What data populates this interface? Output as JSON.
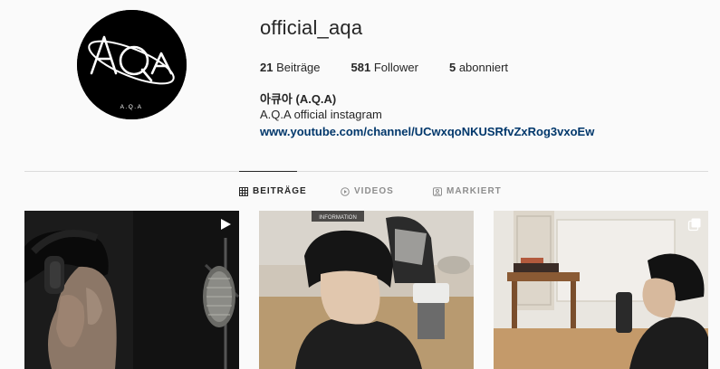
{
  "profile": {
    "username": "official_aqa",
    "avatar_logo_text": "A.Q.A",
    "avatar_small_text": "A.Q.A",
    "full_name": "아큐아 (A.Q.A)",
    "bio": "A.Q.A official instagram",
    "link": "www.youtube.com/channel/UCwxqoNKUSRfvZxRog3vxoEw"
  },
  "stats": {
    "posts": {
      "count": "21",
      "label": "Beiträge"
    },
    "followers": {
      "count": "581",
      "label": "Follower"
    },
    "following": {
      "count": "5",
      "label": "abonniert"
    }
  },
  "tabs": [
    {
      "label": "BEITRÄGE",
      "icon": "grid-icon",
      "active": true
    },
    {
      "label": "VIDEOS",
      "icon": "play-circle-icon",
      "active": false
    },
    {
      "label": "MARKIERT",
      "icon": "tag-user-icon",
      "active": false
    }
  ],
  "posts": [
    {
      "badge": "video-icon",
      "subject": "person with headphones at microphone"
    },
    {
      "badge": "",
      "subject": "person in black turtleneck in salon",
      "sign_text": "INFORMATION"
    },
    {
      "badge": "multiple-images-icon",
      "subject": "person in profile in makeup room"
    }
  ],
  "colors": {
    "background": "#fafafa",
    "text": "#262626",
    "muted": "#8e8e8e",
    "link": "#00376b",
    "divider": "#dbdbdb"
  }
}
